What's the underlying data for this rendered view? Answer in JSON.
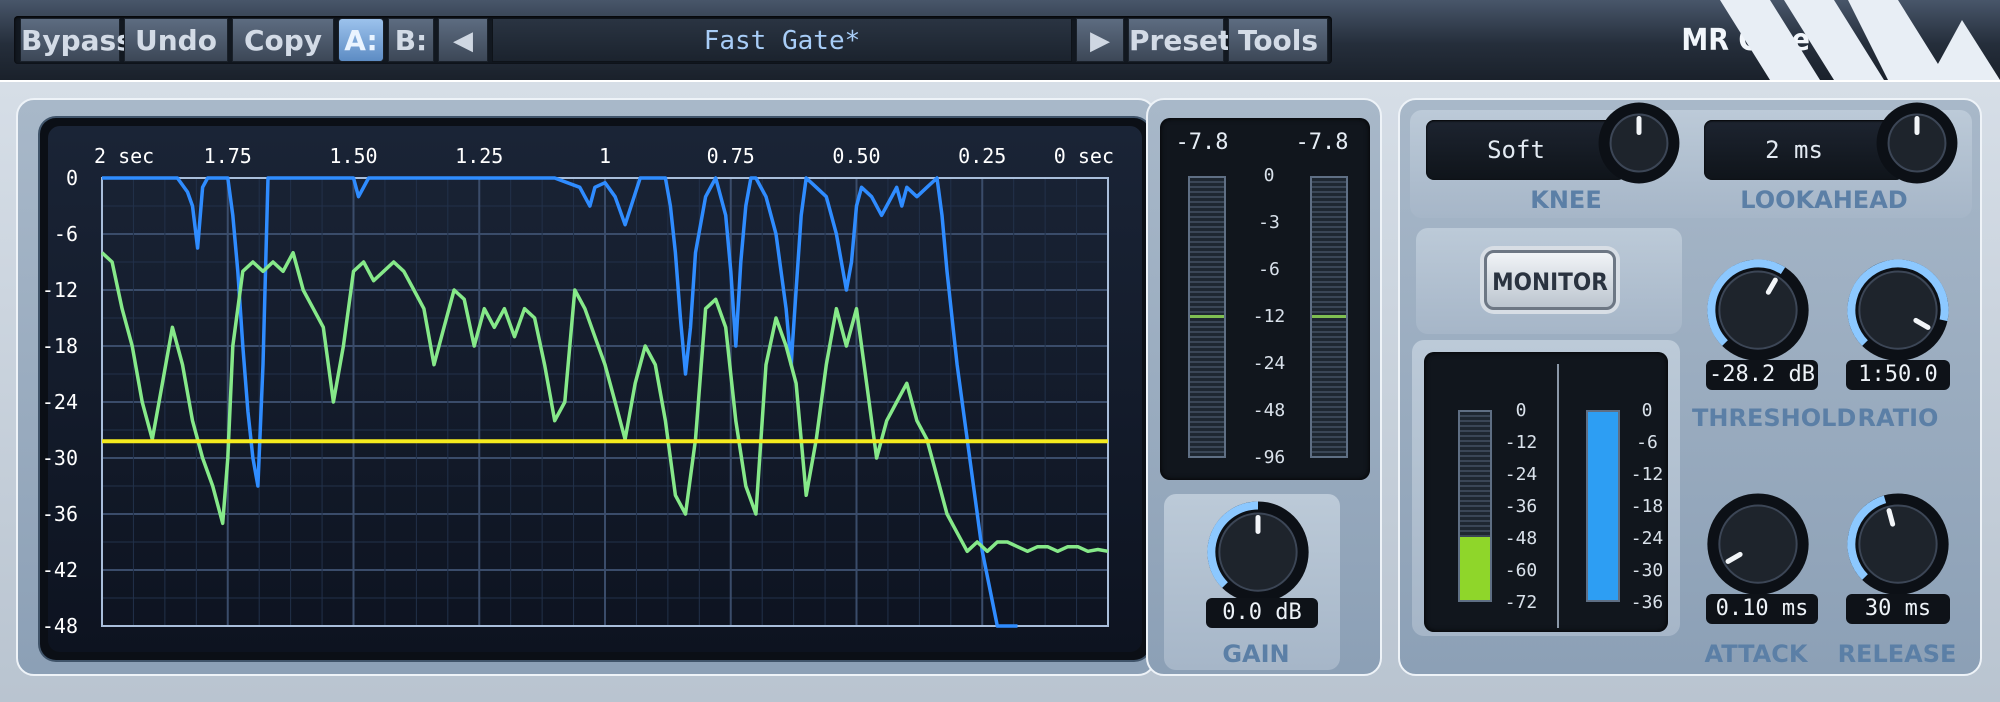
{
  "toolbar": {
    "bypass": "Bypass",
    "undo": "Undo",
    "copy": "Copy",
    "slot_a": "A:",
    "slot_b": "B:",
    "prev_icon": "left-arrow-icon",
    "next_icon": "right-arrow-icon",
    "preset_name": "Fast Gate*",
    "preset": "Preset",
    "tools": "Tools",
    "plugin_title": "MR Gate"
  },
  "graph": {
    "x_ticks": [
      "2 sec",
      "1.75",
      "1.50",
      "1.25",
      "1",
      "0.75",
      "0.50",
      "0.25",
      "0 sec"
    ],
    "y_ticks": [
      "0",
      "-6",
      "-12",
      "-18",
      "-24",
      "-30",
      "-36",
      "-42",
      "-48"
    ]
  },
  "chart_data": {
    "type": "line",
    "x_unit": "sec",
    "xlim": [
      2,
      0
    ],
    "ylim": [
      -48,
      0
    ],
    "threshold": -28.2,
    "series": [
      {
        "color": "#2f8cff",
        "x": [
          2.0,
          1.85,
          1.83,
          1.82,
          1.81,
          1.8,
          1.79,
          1.78,
          1.77,
          1.76,
          1.75,
          1.74,
          1.73,
          1.72,
          1.71,
          1.7,
          1.69,
          1.68,
          1.67,
          1.6,
          1.55,
          1.5,
          1.49,
          1.47,
          1.3,
          1.25,
          1.2,
          1.1,
          1.05,
          1.03,
          1.02,
          1.0,
          0.98,
          0.96,
          0.93,
          0.9,
          0.88,
          0.87,
          0.86,
          0.85,
          0.84,
          0.83,
          0.82,
          0.8,
          0.78,
          0.76,
          0.75,
          0.74,
          0.73,
          0.72,
          0.71,
          0.7,
          0.68,
          0.66,
          0.64,
          0.63,
          0.62,
          0.61,
          0.6,
          0.58,
          0.56,
          0.54,
          0.52,
          0.51,
          0.5,
          0.49,
          0.47,
          0.45,
          0.43,
          0.42,
          0.41,
          0.4,
          0.38,
          0.36,
          0.34,
          0.33,
          0.32,
          0.3,
          0.28,
          0.25,
          0.22,
          0.2,
          0.19,
          0.18
        ],
        "y": [
          0,
          0,
          -1.5,
          -3,
          -7.5,
          -1,
          0,
          0,
          0,
          0,
          0,
          -4,
          -10,
          -18,
          -25,
          -30,
          -33,
          -20,
          0,
          0,
          0,
          0,
          -2,
          0,
          0,
          0,
          0,
          0,
          -1,
          -3,
          -1,
          -0.5,
          -2,
          -5,
          0,
          0,
          0,
          -3,
          -8,
          -15,
          -21,
          -16,
          -8,
          -2,
          0,
          -4,
          -10,
          -18,
          -9,
          -3,
          0,
          0,
          -2,
          -6,
          -14,
          -20,
          -12,
          -4,
          0,
          -1,
          -2,
          -6,
          -12,
          -9,
          -3,
          -1,
          -2,
          -4,
          -2,
          -1,
          -3,
          -1,
          -2,
          -1,
          0,
          -4,
          -10,
          -20,
          -28,
          -40,
          -48,
          -48,
          -48,
          -48
        ]
      },
      {
        "color": "#86e989",
        "x": [
          2.0,
          1.98,
          1.96,
          1.94,
          1.92,
          1.9,
          1.88,
          1.86,
          1.84,
          1.82,
          1.8,
          1.78,
          1.76,
          1.75,
          1.74,
          1.72,
          1.7,
          1.68,
          1.66,
          1.64,
          1.62,
          1.6,
          1.58,
          1.56,
          1.54,
          1.52,
          1.5,
          1.48,
          1.46,
          1.44,
          1.42,
          1.4,
          1.38,
          1.36,
          1.34,
          1.32,
          1.3,
          1.28,
          1.26,
          1.24,
          1.22,
          1.2,
          1.18,
          1.16,
          1.14,
          1.12,
          1.1,
          1.08,
          1.06,
          1.04,
          1.02,
          1.0,
          0.98,
          0.96,
          0.94,
          0.92,
          0.9,
          0.88,
          0.86,
          0.84,
          0.82,
          0.8,
          0.78,
          0.76,
          0.74,
          0.72,
          0.7,
          0.68,
          0.66,
          0.64,
          0.62,
          0.6,
          0.58,
          0.56,
          0.54,
          0.52,
          0.5,
          0.48,
          0.46,
          0.44,
          0.42,
          0.4,
          0.38,
          0.36,
          0.34,
          0.32,
          0.3,
          0.28,
          0.26,
          0.24,
          0.22,
          0.2,
          0.18,
          0.16,
          0.14,
          0.12,
          0.1,
          0.08,
          0.06,
          0.04,
          0.02,
          0.0
        ],
        "y": [
          -8,
          -9,
          -14,
          -18,
          -24,
          -28,
          -22,
          -16,
          -20,
          -26,
          -30,
          -33,
          -37,
          -30,
          -18,
          -10,
          -9,
          -10,
          -9,
          -10,
          -8,
          -12,
          -14,
          -16,
          -24,
          -18,
          -10,
          -9,
          -11,
          -10,
          -9,
          -10,
          -12,
          -14,
          -20,
          -16,
          -12,
          -13,
          -18,
          -14,
          -16,
          -14,
          -17,
          -14,
          -15,
          -20,
          -26,
          -24,
          -12,
          -14,
          -17,
          -20,
          -24,
          -28,
          -22,
          -18,
          -20,
          -26,
          -34,
          -36,
          -28,
          -14,
          -13,
          -16,
          -26,
          -33,
          -36,
          -20,
          -15,
          -18,
          -22,
          -34,
          -28,
          -20,
          -14,
          -18,
          -14,
          -22,
          -30,
          -26,
          -24,
          -22,
          -26,
          -28,
          -32,
          -36,
          -38,
          -40,
          -39,
          -40,
          -39,
          -39,
          -39.5,
          -40,
          -39.5,
          -39.5,
          -40,
          -39.5,
          -39.5,
          -40,
          -39.8,
          -40
        ]
      }
    ]
  },
  "meters_output": {
    "left_value": "-7.8",
    "right_value": "-7.8",
    "scale": [
      "0",
      "-3",
      "-6",
      "-12",
      "-24",
      "-48",
      "-96"
    ],
    "left_level_db": -12,
    "right_level_db": -12
  },
  "gain_knob": {
    "value": "0.0 dB",
    "label": "GAIN"
  },
  "knee": {
    "value": "Soft",
    "label": "KNEE"
  },
  "lookahead": {
    "value": "2 ms",
    "label": "LOOKAHEAD"
  },
  "monitor_label": "MONITOR",
  "meters_gate": {
    "left_scale": [
      "0",
      "-12",
      "-24",
      "-36",
      "-48",
      "-60",
      "-72"
    ],
    "right_scale": [
      "0",
      "-6",
      "-12",
      "-18",
      "-24",
      "-30",
      "-36"
    ],
    "left_level_db": -48,
    "right_level_db": 0
  },
  "threshold": {
    "value": "-28.2 dB",
    "label": "THRESHOLD"
  },
  "ratio": {
    "value": "1:50.0",
    "label": "RATIO"
  },
  "attack": {
    "value": "0.10 ms",
    "label": "ATTACK"
  },
  "release": {
    "value": "30 ms",
    "label": "RELEASE"
  },
  "colors": {
    "accent": "#5b7fa6",
    "knob_arc": "#8cc8ff",
    "gate_meter_green": "#8fd62a",
    "gate_meter_blue": "#2d9ef3",
    "threshold_line": "#f5ea1e"
  }
}
